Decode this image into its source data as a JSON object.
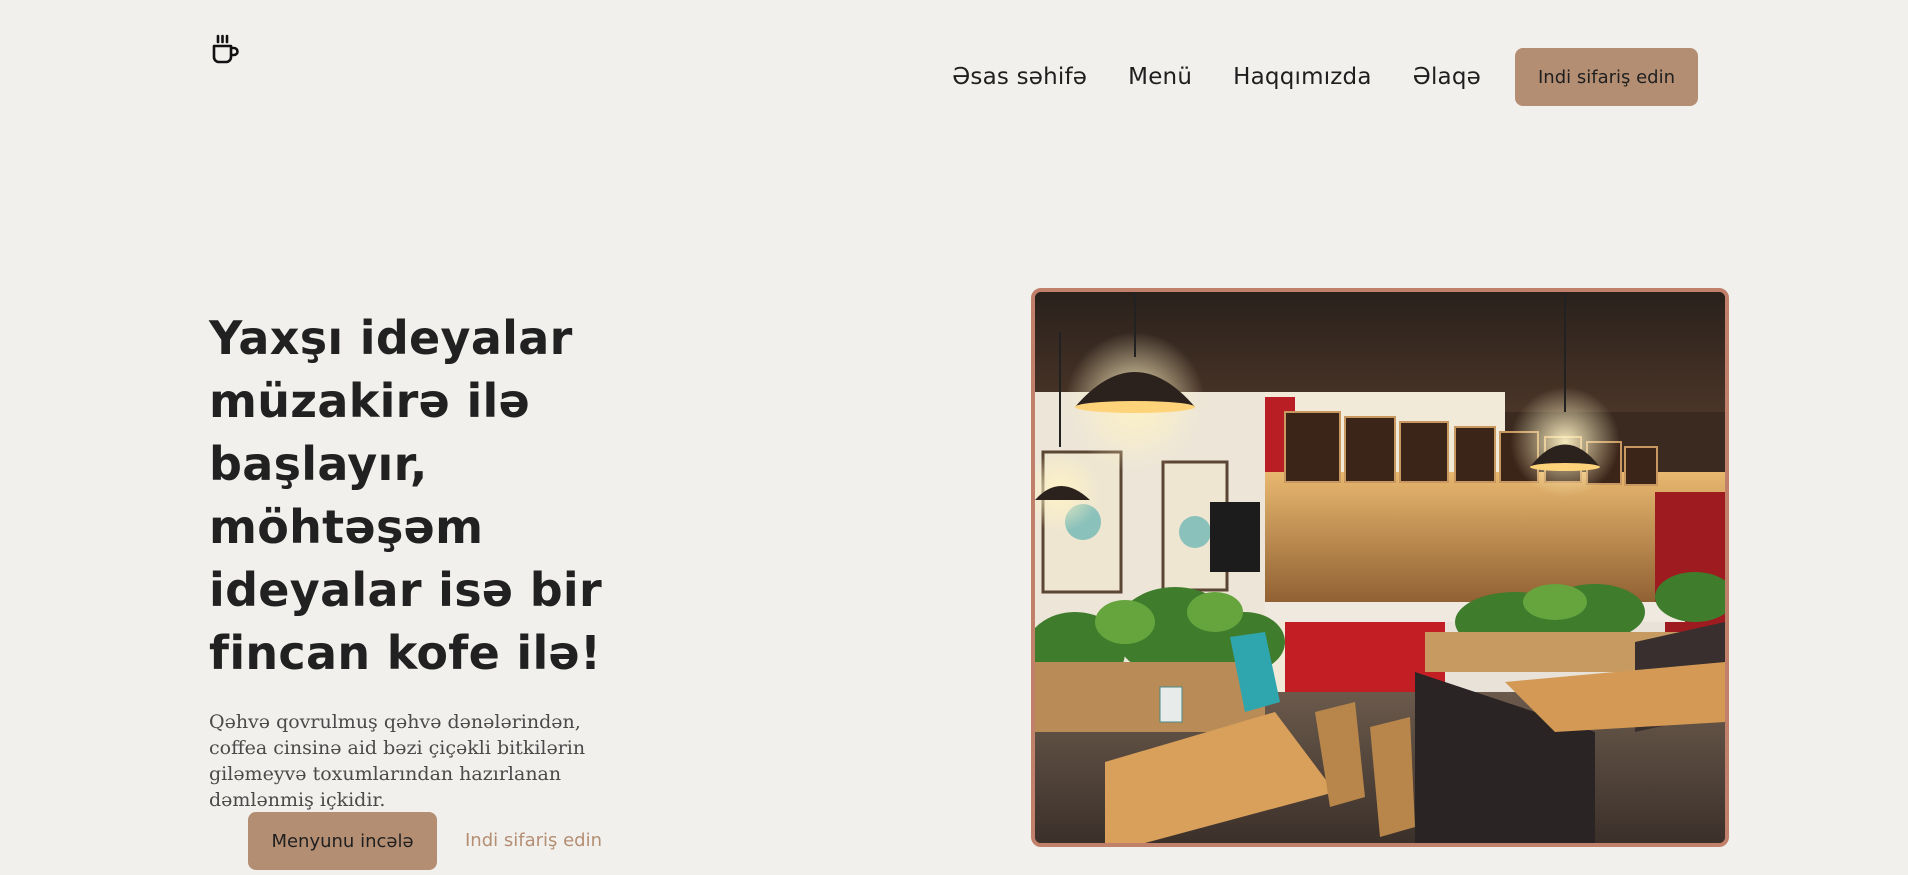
{
  "header": {
    "logo_icon": "coffee-cup-icon",
    "nav": [
      {
        "label": "Əsas səhifə"
      },
      {
        "label": "Menü"
      },
      {
        "label": "Haqqımızda"
      },
      {
        "label": "Əlaqə"
      }
    ],
    "cta_label": "Indi sifariş edin"
  },
  "hero": {
    "title": "Yaxşı ideyalar müzakirə ilə başlayır, möhtəşəm ideyalar isə bir fincan kofe ilə!",
    "description": "Qəhvə qovrulmuş qəhvə dənələrindən, coffea cinsinə aid bəzi çiçəkli bitkilərin giləmeyvə toxumlarından hazırlanan dəmlənmiş içkidir.",
    "primary_button": "Menyunu incələ",
    "secondary_link": "Indi sifariş edin",
    "image_subject": "cafe-interior-photo"
  },
  "colors": {
    "background": "#f2f0ed",
    "accent": "#b38e73",
    "image_border": "#c0806a",
    "text": "#1f1f1f"
  }
}
